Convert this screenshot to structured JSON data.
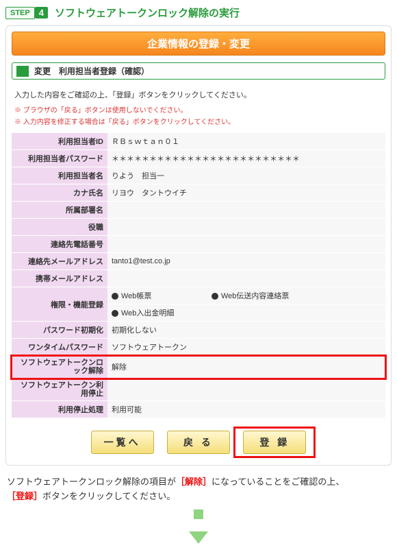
{
  "step": {
    "label": "STEP",
    "num": "4",
    "title": "ソフトウェアトークンロック解除の実行"
  },
  "panel_header": "企業情報の登録・変更",
  "section_title": "変更　利用担当者登録（確認）",
  "instruction": "入力した内容をご確認の上、「登録」ボタンをクリックしてください。",
  "warn1": "※ ブラウザの「戻る」ボタンは使用しないでください。",
  "warn2": "※ 入力内容を修正する場合は「戻る」ボタンをクリックしてください。",
  "rows": {
    "r0": {
      "label": "利用担当者ID",
      "value": "ＲＢｓｗｔａｎ０１"
    },
    "r1": {
      "label": "利用担当者パスワード",
      "value": "＊＊＊＊＊＊＊＊＊＊＊＊＊＊＊＊＊＊＊＊＊＊＊＊＊"
    },
    "r2": {
      "label": "利用担当者名",
      "value": "りよう　担当一"
    },
    "r3": {
      "label": "カナ氏名",
      "value": "リヨウ　タントウイチ"
    },
    "r4": {
      "label": "所属部署名",
      "value": ""
    },
    "r5": {
      "label": "役職",
      "value": ""
    },
    "r6": {
      "label": "連絡先電話番号",
      "value": ""
    },
    "r7": {
      "label": "連絡先メールアドレス",
      "value": "tanto1@test.co.jp"
    },
    "r8": {
      "label": "携帯メールアドレス",
      "value": ""
    },
    "r9": {
      "label": "権限・機能登録",
      "v1": "Web帳票",
      "v2": "Web伝送内容連絡票",
      "v3": "Web入出金明細"
    },
    "r10": {
      "label": "パスワード初期化",
      "value": "初期化しない"
    },
    "r11": {
      "label": "ワンタイムパスワード",
      "value": "ソフトウェアトークン"
    },
    "r12": {
      "label": "ソフトウェアトークンロック解除",
      "value": "解除"
    },
    "r13": {
      "label": "ソフトウェアトークン利用停止",
      "value": ""
    },
    "r14": {
      "label": "利用停止処理",
      "value": "利用可能"
    }
  },
  "buttons": {
    "list": "一覧へ",
    "back": "戻 る",
    "register": "登 録"
  },
  "footnote": {
    "t1": "ソフトウェアトークンロック解除の項目が",
    "kw1": "［解除］",
    "t2": "になっていることをご確認の上、",
    "kw2": "［登録］",
    "t3": "ボタンをクリックしてください。"
  }
}
